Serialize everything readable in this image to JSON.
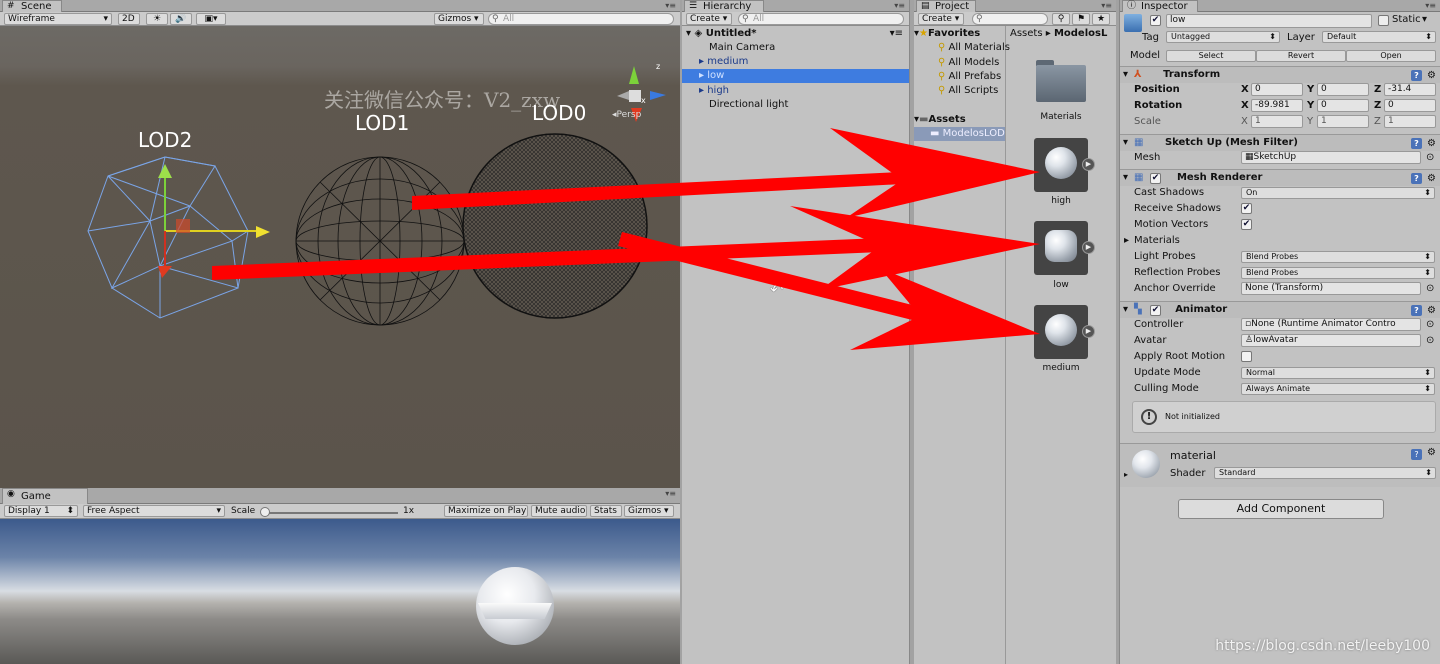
{
  "scene": {
    "tab": "Scene",
    "draw_mode": "Wireframe",
    "btn_2d": "2D",
    "gizmos": "Gizmos",
    "search_placeholder": "All",
    "labels": {
      "lod2": "LOD2",
      "lod1": "LOD1",
      "lod0": "LOD0"
    },
    "watermark": "关注微信公众号：V2_zxw",
    "persp": "Persp",
    "axis_x": "x",
    "axis_z": "z"
  },
  "game": {
    "tab": "Game",
    "display": "Display 1",
    "aspect": "Free Aspect",
    "scale_label": "Scale",
    "scale_value": "1x",
    "maximize": "Maximize on Play",
    "mute": "Mute audio",
    "stats": "Stats",
    "gizmos": "Gizmos"
  },
  "hierarchy": {
    "tab": "Hierarchy",
    "create": "Create",
    "search_placeholder": "All",
    "scene_name": "Untitled*",
    "items": [
      {
        "label": "Main Camera"
      },
      {
        "label": "medium"
      },
      {
        "label": "low"
      },
      {
        "label": "high"
      },
      {
        "label": "Directional light"
      }
    ]
  },
  "project": {
    "tab": "Project",
    "create": "Create",
    "favorites": "Favorites",
    "fav_items": [
      "All Materials",
      "All Models",
      "All Prefabs",
      "All Scripts"
    ],
    "assets": "Assets",
    "asset_folder": "ModelosLOD",
    "breadcrumb": [
      "Assets",
      "ModelosL"
    ],
    "items": [
      {
        "label": "Materials"
      },
      {
        "label": "high"
      },
      {
        "label": "low"
      },
      {
        "label": "medium"
      }
    ]
  },
  "inspector": {
    "tab": "Inspector",
    "name": "low",
    "static": "Static",
    "tag_label": "Tag",
    "tag": "Untagged",
    "layer_label": "Layer",
    "layer": "Default",
    "model_label": "Model",
    "select": "Select",
    "revert": "Revert",
    "open": "Open",
    "transform": {
      "title": "Transform",
      "position_label": "Position",
      "rotation_label": "Rotation",
      "scale_label": "Scale",
      "position": {
        "x": "0",
        "y": "0",
        "z": "-31.4"
      },
      "rotation": {
        "x": "-89.981",
        "y": "0",
        "z": "0"
      },
      "scale": {
        "x": "1",
        "y": "1",
        "z": "1"
      }
    },
    "mesh_filter": {
      "title": "Sketch Up (Mesh Filter)",
      "mesh_label": "Mesh",
      "mesh": "SketchUp"
    },
    "mesh_renderer": {
      "title": "Mesh Renderer",
      "cast_shadows_label": "Cast Shadows",
      "cast_shadows": "On",
      "receive_shadows_label": "Receive Shadows",
      "motion_vectors_label": "Motion Vectors",
      "materials_label": "Materials",
      "light_probes_label": "Light Probes",
      "light_probes": "Blend Probes",
      "reflection_probes_label": "Reflection Probes",
      "reflection_probes": "Blend Probes",
      "anchor_override_label": "Anchor Override",
      "anchor_override": "None (Transform)"
    },
    "animator": {
      "title": "Animator",
      "controller_label": "Controller",
      "controller": "None (Runtime Animator Contro",
      "avatar_label": "Avatar",
      "avatar": "lowAvatar",
      "apply_root_motion_label": "Apply Root Motion",
      "update_mode_label": "Update Mode",
      "update_mode": "Normal",
      "culling_mode_label": "Culling Mode",
      "culling_mode": "Always Animate",
      "info": "Not initialized"
    },
    "material": {
      "name": "material",
      "shader_label": "Shader",
      "shader": "Standard"
    },
    "add_component": "Add Component"
  },
  "footer_url": "https://blog.csdn.net/leeby100",
  "colors": {
    "arrow": "#ff0000",
    "selection": "#3e7ce0"
  }
}
